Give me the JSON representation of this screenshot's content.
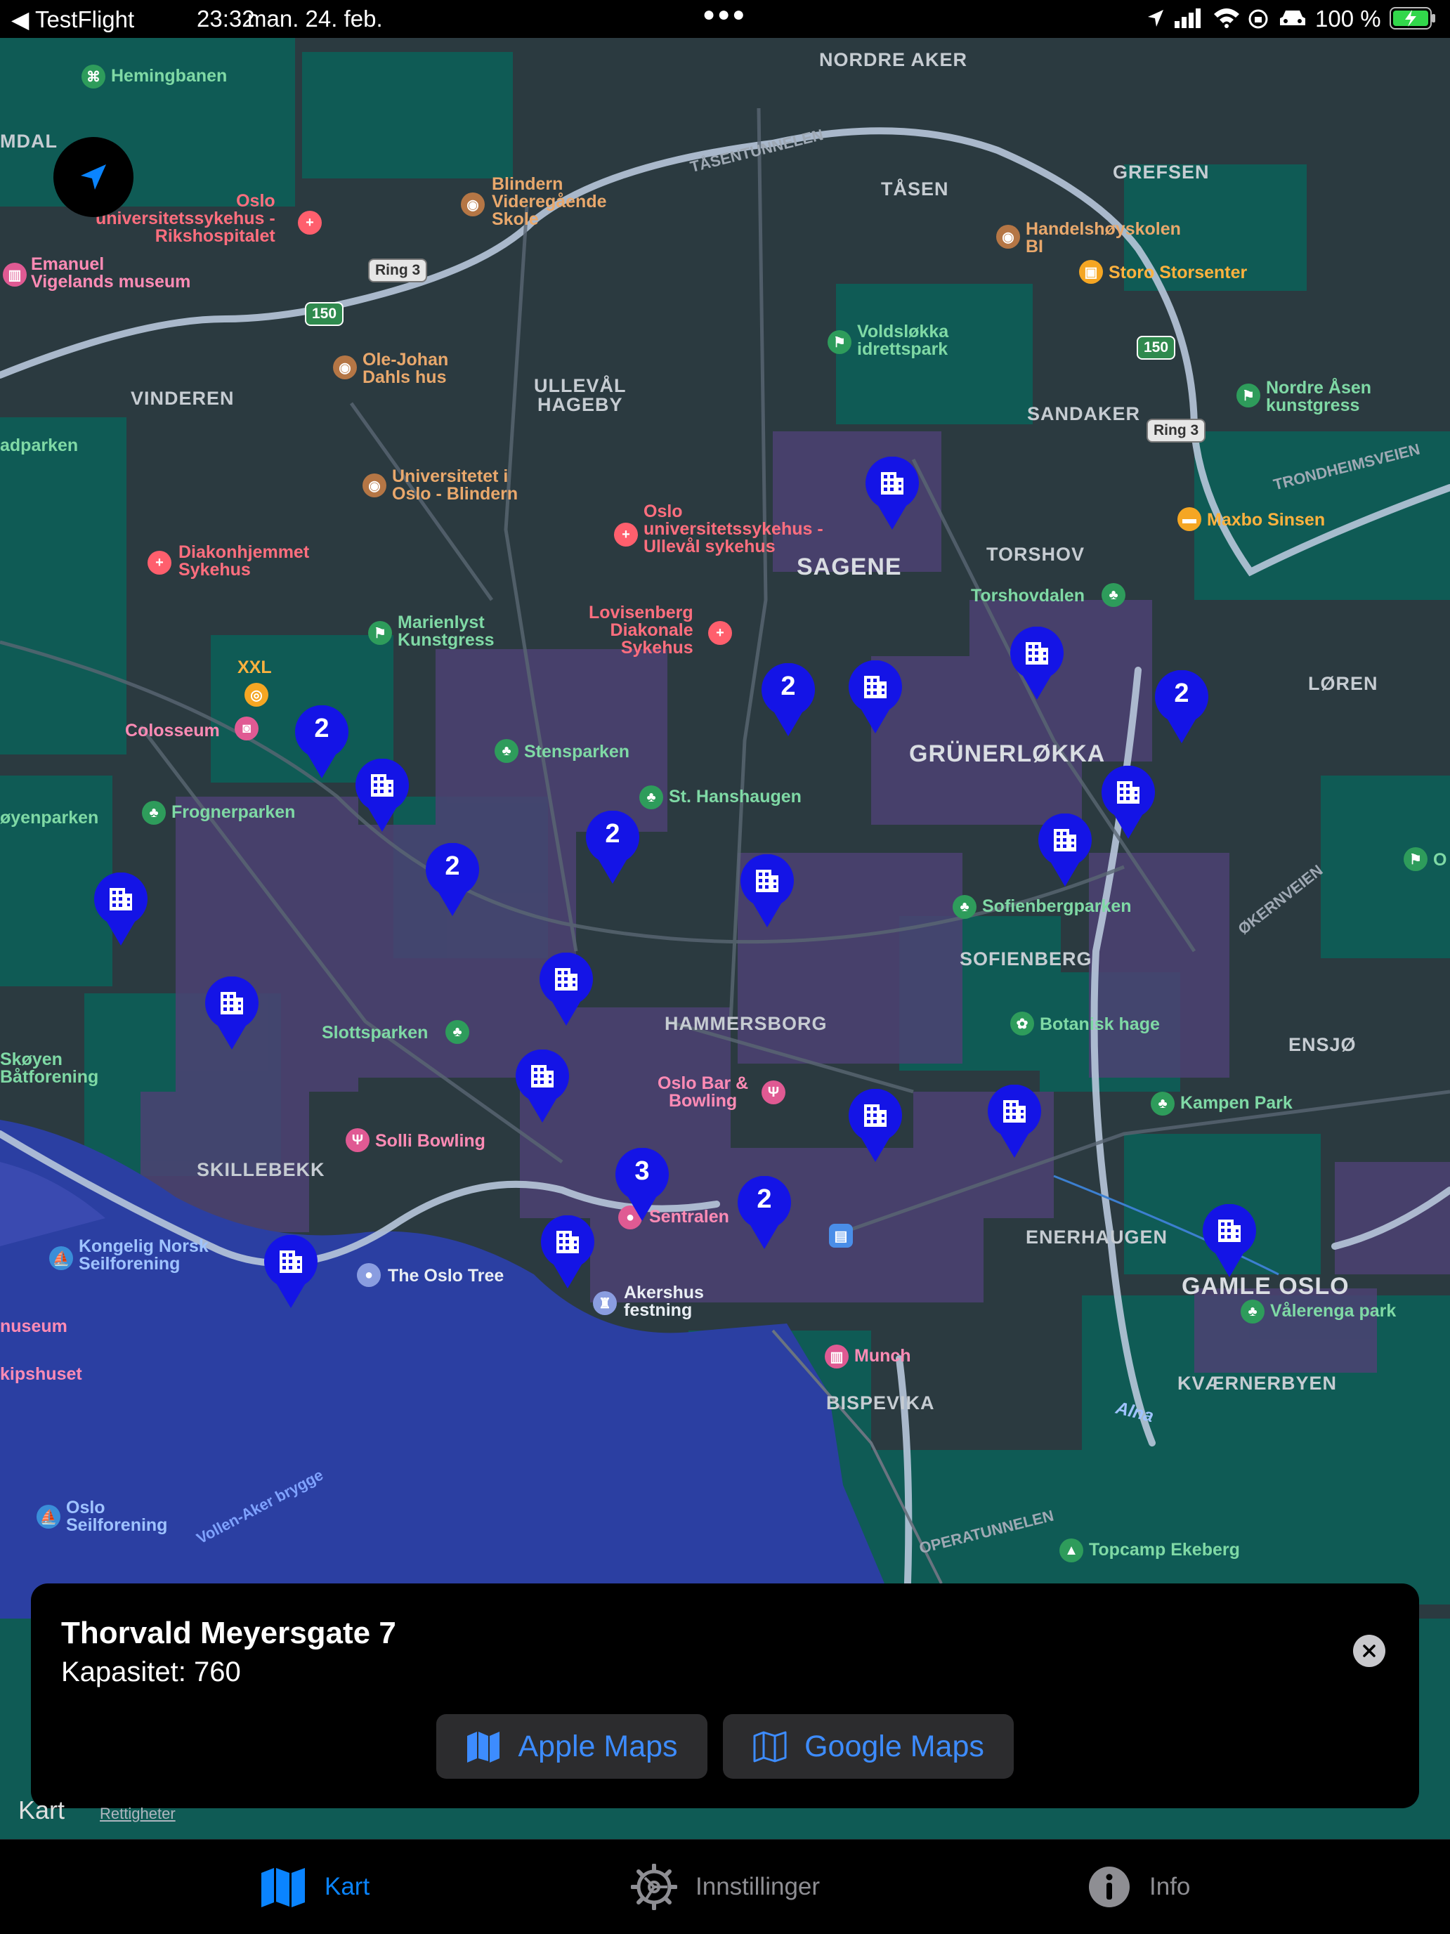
{
  "status_bar": {
    "back_app": "TestFlight",
    "time": "23:32",
    "date": "man. 24. feb.",
    "battery": "100 %"
  },
  "map": {
    "districts": {
      "nordre_aker": "NORDRE AKER",
      "tasen": "TÅSEN",
      "grefsen": "GREFSEN",
      "vinderen": "VINDEREN",
      "ulleval": "ULLEVÅL\nHAGEBY",
      "sandaker": "SANDAKER",
      "sagene": "SAGENE",
      "torshov": "TORSHOV",
      "loren": "LØREN",
      "grunerlokka": "GRÜNERLØKKA",
      "sofienberg": "SOFIENBERG",
      "hammersborg": "HAMMERSBORG",
      "ensjo": "ENSJØ",
      "skillebekk": "SKILLEBEKK",
      "enerhaugen": "ENERHAUGEN",
      "gamle_oslo": "GAMLE OSLO",
      "kvaernerbyen": "KVÆRNERBYEN",
      "bispevika": "BISPEVIKA",
      "mdal": "MDAL"
    },
    "pois": {
      "hemingbanen": "Hemingbanen",
      "rikshospitalet": "Oslo\nuniversitetssykehus -\nRikshospitalet",
      "blindern_vgs": "Blindern\nVideregående\nSkole",
      "vigeland": "Emanuel\nVigelands museum",
      "handelshoyskolen": "Handelshøyskolen\nBI",
      "storo": "Storo Storsenter",
      "voldslokka": "Voldsløkka\nidrettspark",
      "ole_johan": "Ole-Johan\nDahls hus",
      "nordre_asen": "Nordre Åsen\nkunstgress",
      "adparken": "adparken",
      "uio": "Universitetet i\nOslo - Blindern",
      "ulleval_sykehus": "Oslo\nuniversitetssykehus -\nUllevål sykehus",
      "maxbo": "Maxbo Sinsen",
      "diakonhjemmet": "Diakonhjemmet\nSykehus",
      "torshovdalen": "Torshovdalen",
      "marienlyst": "Marienlyst\nKunstgress",
      "lovisenberg": "Lovisenberg\nDiakonale\nSykehus",
      "xxl": "XXL",
      "colosseum": "Colosseum",
      "stensparken": "Stensparken",
      "st_hanshaugen": "St. Hanshaugen",
      "oyenparken": "øyenparken",
      "frognerparken": "Frognerparken",
      "sofienbergparken": "Sofienbergparken",
      "skoyen": "Skøyen\nBåtforening",
      "slottsparken": "Slottsparken",
      "botanisk": "Botanisk hage",
      "oslo_bar": "Oslo Bar &\nBowling",
      "kampen": "Kampen Park",
      "solli": "Solli Bowling",
      "sentralen": "Sentralen",
      "kongelig": "Kongelig Norsk\nSeilforening",
      "oslo_tree": "The Oslo Tree",
      "akershus": "Akershus\nfestning",
      "valerenga": "Vålerenga park",
      "museum": "nuseum",
      "kipshuset": "kipshuset",
      "munch": "Munch",
      "alna": "Alna",
      "oslo_seil": "Oslo\nSeilforening",
      "topcamp": "Topcamp Ekeberg",
      "edge_o": "O"
    },
    "roads": {
      "tasentunnelen": "TÅSENTUNNELEN",
      "trondheimsveien": "TRONDHEIMSVEIEN",
      "okernveien": "ØKERNVEIEN",
      "operatunnelen": "OPERATUNNELEN",
      "vollen": "Vollen-Aker brygge",
      "ring3": "Ring 3",
      "e150": "150"
    },
    "clusters": [
      "2",
      "2",
      "2",
      "2",
      "2",
      "3",
      "2"
    ],
    "colors": {
      "pin": "#1414e6",
      "land": "#0f5c56",
      "water": "#2a3ea0"
    }
  },
  "info_card": {
    "title": "Thorvald Meyersgate 7",
    "capacity": "Kapasitet: 760",
    "apple_maps": "Apple Maps",
    "google_maps": "Google Maps"
  },
  "attribution": {
    "brand": "Kart",
    "legal": "Rettigheter"
  },
  "tabs": [
    {
      "label": "Kart",
      "icon": "map-icon",
      "active": true
    },
    {
      "label": "Innstillinger",
      "icon": "gear-icon",
      "active": false
    },
    {
      "label": "Info",
      "icon": "info-icon",
      "active": false
    }
  ]
}
